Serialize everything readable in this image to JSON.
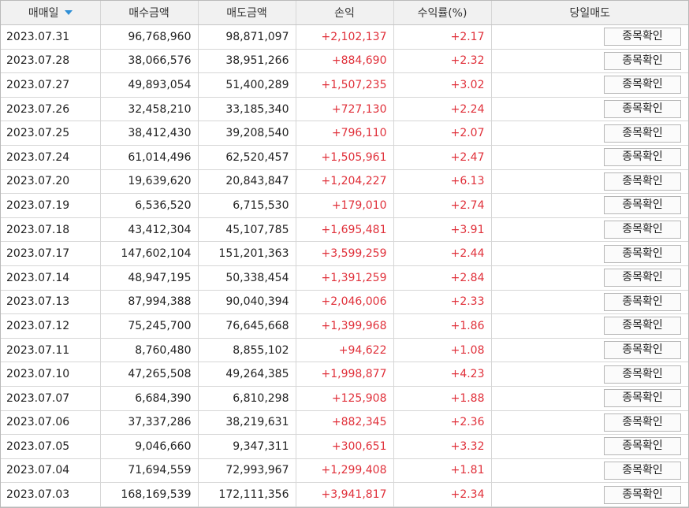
{
  "headers": {
    "date": "매매일",
    "buy_amount": "매수금액",
    "sell_amount": "매도금액",
    "profit_loss": "손익",
    "return_rate": "수익률(%)",
    "same_day_sell": "당일매도"
  },
  "sort_indicator": "sort-descending-icon",
  "profit_color": "#e0303a",
  "rows": [
    {
      "date": "2023.07.31",
      "buy": "96,768,960",
      "sell": "98,871,097",
      "pl": "+2,102,137",
      "rate": "+2.17",
      "action": "종목확인"
    },
    {
      "date": "2023.07.28",
      "buy": "38,066,576",
      "sell": "38,951,266",
      "pl": "+884,690",
      "rate": "+2.32",
      "action": "종목확인"
    },
    {
      "date": "2023.07.27",
      "buy": "49,893,054",
      "sell": "51,400,289",
      "pl": "+1,507,235",
      "rate": "+3.02",
      "action": "종목확인"
    },
    {
      "date": "2023.07.26",
      "buy": "32,458,210",
      "sell": "33,185,340",
      "pl": "+727,130",
      "rate": "+2.24",
      "action": "종목확인"
    },
    {
      "date": "2023.07.25",
      "buy": "38,412,430",
      "sell": "39,208,540",
      "pl": "+796,110",
      "rate": "+2.07",
      "action": "종목확인"
    },
    {
      "date": "2023.07.24",
      "buy": "61,014,496",
      "sell": "62,520,457",
      "pl": "+1,505,961",
      "rate": "+2.47",
      "action": "종목확인"
    },
    {
      "date": "2023.07.20",
      "buy": "19,639,620",
      "sell": "20,843,847",
      "pl": "+1,204,227",
      "rate": "+6.13",
      "action": "종목확인"
    },
    {
      "date": "2023.07.19",
      "buy": "6,536,520",
      "sell": "6,715,530",
      "pl": "+179,010",
      "rate": "+2.74",
      "action": "종목확인"
    },
    {
      "date": "2023.07.18",
      "buy": "43,412,304",
      "sell": "45,107,785",
      "pl": "+1,695,481",
      "rate": "+3.91",
      "action": "종목확인"
    },
    {
      "date": "2023.07.17",
      "buy": "147,602,104",
      "sell": "151,201,363",
      "pl": "+3,599,259",
      "rate": "+2.44",
      "action": "종목확인"
    },
    {
      "date": "2023.07.14",
      "buy": "48,947,195",
      "sell": "50,338,454",
      "pl": "+1,391,259",
      "rate": "+2.84",
      "action": "종목확인"
    },
    {
      "date": "2023.07.13",
      "buy": "87,994,388",
      "sell": "90,040,394",
      "pl": "+2,046,006",
      "rate": "+2.33",
      "action": "종목확인"
    },
    {
      "date": "2023.07.12",
      "buy": "75,245,700",
      "sell": "76,645,668",
      "pl": "+1,399,968",
      "rate": "+1.86",
      "action": "종목확인"
    },
    {
      "date": "2023.07.11",
      "buy": "8,760,480",
      "sell": "8,855,102",
      "pl": "+94,622",
      "rate": "+1.08",
      "action": "종목확인"
    },
    {
      "date": "2023.07.10",
      "buy": "47,265,508",
      "sell": "49,264,385",
      "pl": "+1,998,877",
      "rate": "+4.23",
      "action": "종목확인"
    },
    {
      "date": "2023.07.07",
      "buy": "6,684,390",
      "sell": "6,810,298",
      "pl": "+125,908",
      "rate": "+1.88",
      "action": "종목확인"
    },
    {
      "date": "2023.07.06",
      "buy": "37,337,286",
      "sell": "38,219,631",
      "pl": "+882,345",
      "rate": "+2.36",
      "action": "종목확인"
    },
    {
      "date": "2023.07.05",
      "buy": "9,046,660",
      "sell": "9,347,311",
      "pl": "+300,651",
      "rate": "+3.32",
      "action": "종목확인"
    },
    {
      "date": "2023.07.04",
      "buy": "71,694,559",
      "sell": "72,993,967",
      "pl": "+1,299,408",
      "rate": "+1.81",
      "action": "종목확인"
    },
    {
      "date": "2023.07.03",
      "buy": "168,169,539",
      "sell": "172,111,356",
      "pl": "+3,941,817",
      "rate": "+2.34",
      "action": "종목확인"
    }
  ]
}
